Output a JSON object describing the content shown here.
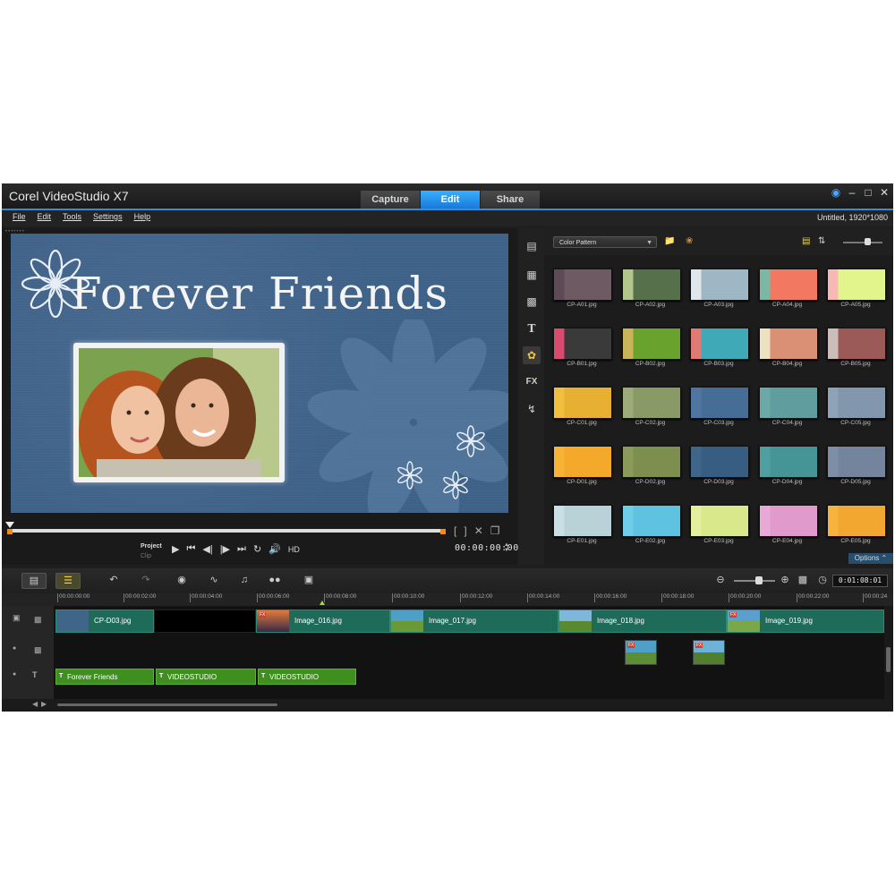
{
  "window": {
    "title": "Corel VideoStudio X7",
    "tabs": [
      {
        "label": "Capture",
        "active": false
      },
      {
        "label": "Edit",
        "active": true
      },
      {
        "label": "Share",
        "active": false
      }
    ],
    "controls": [
      "globe-icon",
      "minimize-icon",
      "maximize-icon",
      "close-icon"
    ]
  },
  "menu": {
    "items": [
      "File",
      "Edit",
      "Tools",
      "Settings",
      "Help"
    ],
    "project_info": "Untitled, 1920*1080"
  },
  "preview": {
    "title_text": "Forever Friends",
    "mode_project": "Project",
    "mode_clip": "Clip",
    "hd_label": "HD",
    "timecode": "00:00:00:00"
  },
  "library": {
    "category": "Color Pattern",
    "options_label": "Options",
    "items": [
      {
        "label": "CP-A01.jpg",
        "colors": [
          "#5e4a55",
          "#6d5a63"
        ]
      },
      {
        "label": "CP-A02.jpg",
        "colors": [
          "#b2c58a",
          "#55704a"
        ]
      },
      {
        "label": "CP-A03.jpg",
        "colors": [
          "#dfe7ec",
          "#9fb6c4"
        ]
      },
      {
        "label": "CP-A04.jpg",
        "colors": [
          "#7ab7a5",
          "#f27862"
        ]
      },
      {
        "label": "CP-A05.jpg",
        "colors": [
          "#f8b9b6",
          "#e2f58d"
        ]
      },
      {
        "label": "CP-B01.jpg",
        "colors": [
          "#d94a6d",
          "#3a3a3a"
        ]
      },
      {
        "label": "CP-B02.jpg",
        "colors": [
          "#c9b45a",
          "#6aa22e"
        ]
      },
      {
        "label": "CP-B03.jpg",
        "colors": [
          "#e07a74",
          "#3fa9b8"
        ]
      },
      {
        "label": "CP-B04.jpg",
        "colors": [
          "#eee1c0",
          "#d99074"
        ]
      },
      {
        "label": "CP-B05.jpg",
        "colors": [
          "#cbbdb8",
          "#9b5a58"
        ]
      },
      {
        "label": "CP-C01.jpg",
        "colors": [
          "#f2be3e",
          "#e7b032"
        ]
      },
      {
        "label": "CP-C02.jpg",
        "colors": [
          "#9cab78",
          "#8a9a66"
        ]
      },
      {
        "label": "CP-C03.jpg",
        "colors": [
          "#4f76a0",
          "#466d96"
        ]
      },
      {
        "label": "CP-C04.jpg",
        "colors": [
          "#6ba8a8",
          "#609d9e"
        ]
      },
      {
        "label": "CP-C05.jpg",
        "colors": [
          "#8ea3b8",
          "#8297ad"
        ]
      },
      {
        "label": "CP-D01.jpg",
        "colors": [
          "#f7b335",
          "#f4a92a"
        ]
      },
      {
        "label": "CP-D02.jpg",
        "colors": [
          "#8a9a5a",
          "#7d8e4e"
        ]
      },
      {
        "label": "CP-D03.jpg",
        "colors": [
          "#3f6689",
          "#375e82"
        ]
      },
      {
        "label": "CP-D04.jpg",
        "colors": [
          "#4f9fa0",
          "#469596"
        ]
      },
      {
        "label": "CP-D05.jpg",
        "colors": [
          "#7d8ea6",
          "#73849c"
        ]
      },
      {
        "label": "CP-E01.jpg",
        "colors": [
          "#c8dfe3",
          "#b8d2d8"
        ]
      },
      {
        "label": "CP-E02.jpg",
        "colors": [
          "#6fcde8",
          "#5ec3e0"
        ]
      },
      {
        "label": "CP-E03.jpg",
        "colors": [
          "#e4f09b",
          "#d8e88a"
        ]
      },
      {
        "label": "CP-E04.jpg",
        "colors": [
          "#e9a8d6",
          "#e09acc"
        ]
      },
      {
        "label": "CP-E05.jpg",
        "colors": [
          "#f8b33f",
          "#f2a830"
        ]
      }
    ]
  },
  "timeline": {
    "project_timecode": "0:01:08:01",
    "ruler": [
      "00:00:00:00",
      "00:00:02:00",
      "00:00:04:00",
      "00:00:06:00",
      "00:00:08:00",
      "00:00:10:00",
      "00:00:12:00",
      "00:00:14:00",
      "00:00:16:00",
      "00:00:18:00",
      "00:00:20:00",
      "00:00:22:00",
      "00:00:24"
    ],
    "video_clips": [
      {
        "label": "CP-D03.jpg",
        "fx": false
      },
      {
        "label": "Image_016.jpg",
        "fx": true
      },
      {
        "label": "Image_017.jpg",
        "fx": false
      },
      {
        "label": "Image_018.jpg",
        "fx": false
      },
      {
        "label": "Image_019.jpg",
        "fx": true
      }
    ],
    "fx_badge": "FX",
    "title_clips": [
      "Forever Friends",
      "VIDEOSTUDIO",
      "VIDEOSTUDIO"
    ],
    "title_badge": "T"
  }
}
